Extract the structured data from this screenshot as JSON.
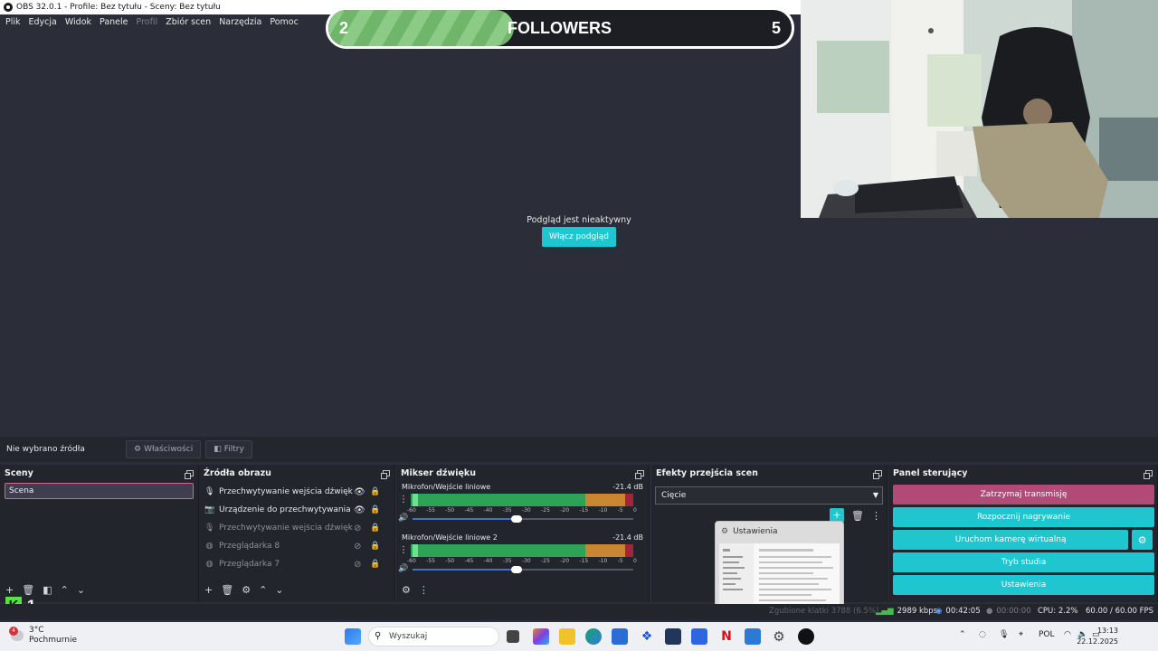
{
  "window": {
    "title": "OBS 32.0.1 - Profile: Bez tytułu - Sceny: Bez tytułu"
  },
  "menu": [
    "Plik",
    "Edycja",
    "Widok",
    "Panele",
    "Profil",
    "Zbiór scen",
    "Narzędzia",
    "Pomoc"
  ],
  "overlay": {
    "current": "2",
    "label": "FOLLOWERS",
    "goal": "5",
    "progress_fraction": 0.4
  },
  "preview": {
    "message": "Podgląd jest nieaktywny",
    "enable_button": "Włącz podgląd"
  },
  "source_bar": {
    "no_source": "Nie wybrano źródła",
    "properties": "Właściwości",
    "filters": "Filtry"
  },
  "scenes": {
    "title": "Sceny",
    "items": [
      "Scena"
    ]
  },
  "sources": {
    "title": "Źródła obrazu",
    "items": [
      {
        "name": "Przechwytywanie wejścia dźwięku 2",
        "icon": "microphone-icon",
        "visible": true,
        "locked": false
      },
      {
        "name": "Urządzenie do przechwytywania wideo",
        "icon": "camera-icon",
        "visible": true,
        "locked": false
      },
      {
        "name": "Przechwytywanie wejścia dźwięku",
        "icon": "microphone-icon",
        "visible": false,
        "locked": true
      },
      {
        "name": "Przeglądarka 8",
        "icon": "globe-icon",
        "visible": false,
        "locked": false
      },
      {
        "name": "Przeglądarka 7",
        "icon": "globe-icon",
        "visible": false,
        "locked": false
      }
    ]
  },
  "mixer": {
    "title": "Mikser dźwięku",
    "channels": [
      {
        "name": "Mikrofon/Wejście liniowe",
        "db": "-21.4 dB",
        "volume_fraction": 0.47
      },
      {
        "name": "Mikrofon/Wejście liniowe 2",
        "db": "-21.4 dB",
        "volume_fraction": 0.47
      }
    ],
    "ticks": [
      "-60",
      "-55",
      "-50",
      "-45",
      "-40",
      "-35",
      "-30",
      "-25",
      "-20",
      "-15",
      "-10",
      "-5",
      "0"
    ]
  },
  "transitions": {
    "title": "Efekty przejścia scen",
    "selected": "Cięcie"
  },
  "controls": {
    "title": "Panel sterujący",
    "stop_stream": "Zatrzymaj transmisję",
    "start_recording": "Rozpocznij nagrywanie",
    "virtual_camera": "Uruchom kamerę wirtualną",
    "studio_mode": "Tryb studia",
    "settings": "Ustawienia"
  },
  "settings_thumbnail": {
    "title": "Ustawienia"
  },
  "status": {
    "dropped": "Zgubione klatki 3788 (6.5%)",
    "bitrate": "2989 kbps",
    "stream_time": "00:42:05",
    "rec_time": "00:00:00",
    "cpu": "CPU: 2.2%",
    "fps": "60.00 / 60.00 FPS"
  },
  "kick": {
    "logo": "K",
    "count": "1"
  },
  "taskbar": {
    "temperature": "3°C",
    "weather": "Pochmurnie",
    "weather_badge": "4",
    "search_placeholder": "Wyszukaj",
    "language": "POL",
    "time": "13:13",
    "date": "22.12.2025"
  },
  "colors": {
    "accent": "#1fc6cf",
    "stop": "#b34977",
    "background": "#2b2e38",
    "dock": "#23252c"
  }
}
